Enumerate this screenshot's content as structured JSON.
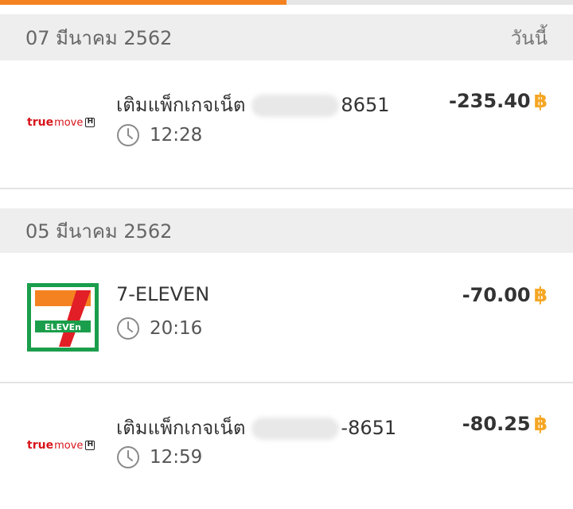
{
  "progress": {
    "fraction": 0.5
  },
  "colors": {
    "accent": "#f58220",
    "baht": "#f5a623",
    "seven_green": "#1a9e4b",
    "seven_orange": "#f58220",
    "seven_red": "#e21f26"
  },
  "groups": [
    {
      "date": "07 มีนาคม 2562",
      "relative": "วันนี้",
      "transactions": [
        {
          "logo": "truemove-h-logo",
          "logo_text_a": "true",
          "logo_text_b": "move",
          "logo_text_c": "H",
          "title_prefix": "เติมแพ็กเกจเน็ต",
          "title_suffix": "8651",
          "time": "12:28",
          "amount": "-235.40",
          "currency": "฿"
        }
      ]
    },
    {
      "date": "05 มีนาคม 2562",
      "relative": "",
      "transactions": [
        {
          "logo": "seven-eleven-logo",
          "logo_text": "ELEVEn",
          "title": "7-ELEVEN",
          "time": "20:16",
          "amount": "-70.00",
          "currency": "฿"
        },
        {
          "logo": "truemove-h-logo",
          "logo_text_a": "true",
          "logo_text_b": "move",
          "logo_text_c": "H",
          "title_prefix": "เติมแพ็กเกจเน็ต",
          "title_suffix": "-8651",
          "time": "12:59",
          "amount": "-80.25",
          "currency": "฿"
        }
      ]
    }
  ]
}
